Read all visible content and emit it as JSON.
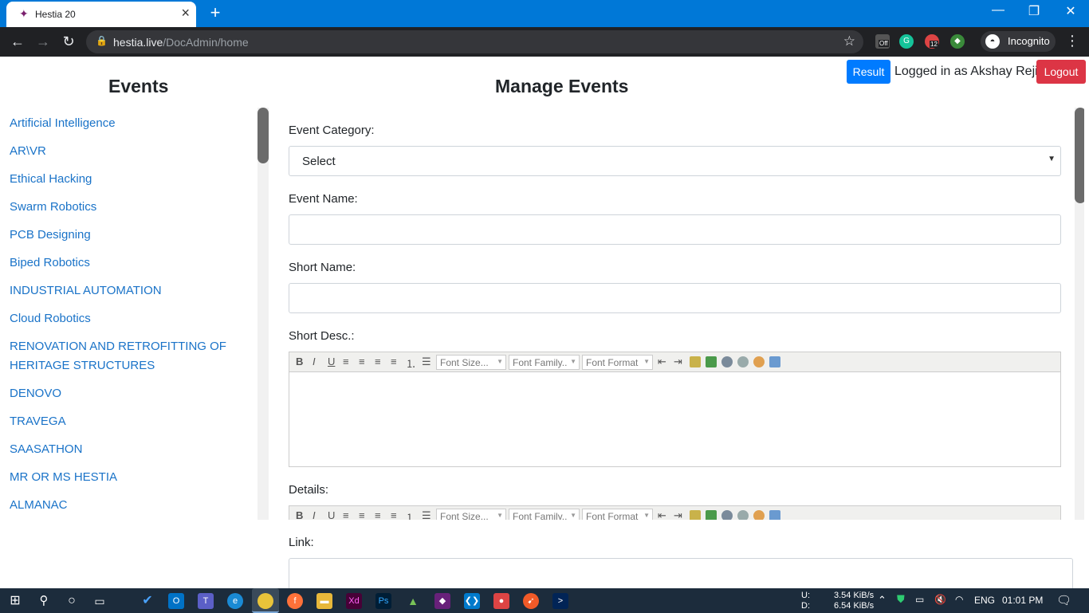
{
  "browser": {
    "tab_title": "Hestia 20",
    "url_host": "hestia.live",
    "url_path": "/DocAdmin/home",
    "incognito_label": "Incognito",
    "ext_badge_off": "Off",
    "ext_badge_count": "12"
  },
  "header": {
    "events_title": "Events",
    "manage_title": "Manage Events",
    "result_button": "Result",
    "logged_in_text": "Logged in as Akshay Reji",
    "logout_button": "Logout"
  },
  "events": [
    "Artificial Intelligence",
    "AR\\VR",
    "Ethical Hacking",
    "Swarm Robotics",
    "PCB Designing",
    "Biped Robotics",
    "INDUSTRIAL AUTOMATION",
    "Cloud Robotics",
    "RENOVATION AND RETROFITTING OF",
    "HERITAGE STRUCTURES",
    "DENOVO",
    "TRAVEGA",
    "SAASATHON",
    "MR OR MS HESTIA",
    "ALMANAC"
  ],
  "form": {
    "category_label": "Event Category:",
    "category_value": "Select",
    "name_label": "Event Name:",
    "short_name_label": "Short Name:",
    "short_desc_label": "Short Desc.:",
    "details_label": "Details:",
    "link_label": "Link:",
    "editor": {
      "font_size": "Font Size...",
      "font_family": "Font Family..",
      "font_format": "Font Format"
    }
  },
  "taskbar": {
    "net_up_label": "U:",
    "net_down_label": "D:",
    "net_up": "3.54 KiB/s",
    "net_down": "6.54 KiB/s",
    "lang": "ENG",
    "time": "01:01 PM"
  }
}
